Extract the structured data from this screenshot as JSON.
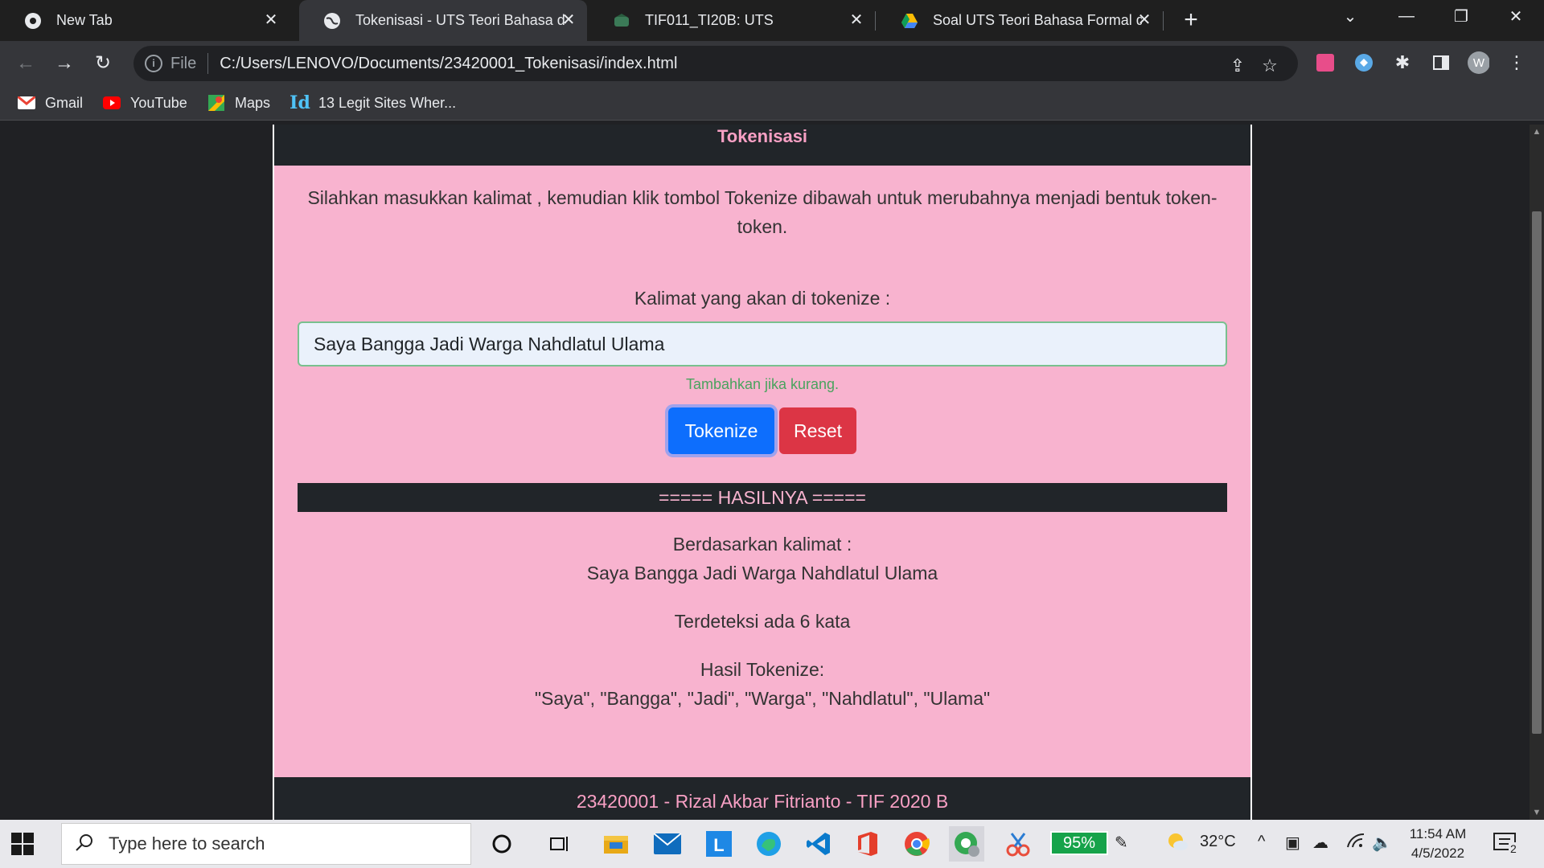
{
  "browser": {
    "tabs": [
      {
        "title": "New Tab",
        "active": false
      },
      {
        "title": "Tokenisasi - UTS Teori Bahasa dan",
        "active": true
      },
      {
        "title": "TIF011_TI20B: UTS",
        "active": false
      },
      {
        "title": "Soal UTS Teori Bahasa Formal dan",
        "active": false
      }
    ],
    "address": {
      "scheme": "File",
      "url": "C:/Users/LENOVO/Documents/23420001_Tokenisasi/index.html"
    },
    "bookmarks": [
      {
        "label": "Gmail",
        "icon": "gmail-icon"
      },
      {
        "label": "YouTube",
        "icon": "youtube-icon"
      },
      {
        "label": "Maps",
        "icon": "maps-icon"
      },
      {
        "label": "13 Legit Sites Wher...",
        "icon": "id-icon"
      }
    ],
    "profile_initial": "W"
  },
  "page": {
    "header": "Tokenisasi",
    "intro": "Silahkan masukkan kalimat , kemudian klik tombol Tokenize dibawah untuk merubahnya menjadi bentuk token-token.",
    "input_label": "Kalimat yang akan di tokenize :",
    "input_value": "Saya Bangga Jadi Warga Nahdlatul Ulama",
    "hint": "Tambahkan jika kurang.",
    "tokenize_label": "Tokenize",
    "reset_label": "Reset",
    "result_header": "===== HASILNYA =====",
    "based_on_label": "Berdasarkan kalimat :",
    "based_on_value": "Saya Bangga Jadi Warga Nahdlatul Ulama",
    "word_count": "Terdeteksi ada 6 kata",
    "tokens_label": "Hasil Tokenize:",
    "tokens_value": "\"Saya\", \"Bangga\", \"Jadi\", \"Warga\", \"Nahdlatul\", \"Ulama\"",
    "footer": "23420001 - Rizal Akbar Fitrianto - TIF 2020 B"
  },
  "taskbar": {
    "search_placeholder": "Type here to search",
    "battery": "95%",
    "temperature": "32°C",
    "time": "11:54 AM",
    "date": "4/5/2022",
    "notifications": "2"
  },
  "colors": {
    "page_bg": "#f8b3cf",
    "dark": "#212529",
    "primary": "#0d6efd",
    "danger": "#dc3545",
    "hint": "#4aa35e"
  }
}
